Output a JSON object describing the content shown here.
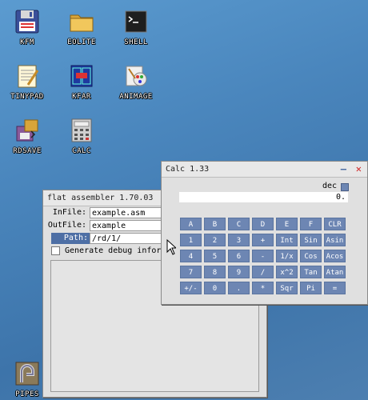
{
  "desktop": {
    "icons": [
      {
        "label": "KFM",
        "icon": "floppy-icon"
      },
      {
        "label": "EOLITE",
        "icon": "folder-icon"
      },
      {
        "label": "SHELL",
        "icon": "terminal-icon"
      },
      {
        "label": "TINYPAD",
        "icon": "notepad-icon"
      },
      {
        "label": "KFAR",
        "icon": "dual-panel-icon"
      },
      {
        "label": "ANIMAGE",
        "icon": "paint-icon"
      },
      {
        "label": "RDSAVE",
        "icon": "rdsave-icon"
      },
      {
        "label": "CALC",
        "icon": "calculator-icon"
      },
      {
        "label": "PIPES",
        "icon": "pipes-icon"
      }
    ]
  },
  "fasm": {
    "title": "flat assembler 1.70.03",
    "infile_label": "InFile:",
    "infile_value": "example.asm",
    "outfile_label": "OutFile:",
    "outfile_value": "example",
    "path_label": "Path:",
    "path_value": "/rd/1/",
    "debug_label": "Generate debug infor",
    "debug_checked": false
  },
  "calc": {
    "title": "Calc 1.33",
    "mode_label": "dec",
    "display_value": "0.",
    "buttons": [
      [
        "A",
        "B",
        "C",
        "D",
        "E",
        "F",
        "CLR"
      ],
      [
        "1",
        "2",
        "3",
        "+",
        "Int",
        "Sin",
        "Asin"
      ],
      [
        "4",
        "5",
        "6",
        "-",
        "1/x",
        "Cos",
        "Acos"
      ],
      [
        "7",
        "8",
        "9",
        "/",
        "x^2",
        "Tan",
        "Atan"
      ],
      [
        "+/-",
        "0",
        ".",
        "*",
        "Sqr",
        "Pi",
        "="
      ]
    ]
  },
  "colors": {
    "accent": "#4e6fa5",
    "button": "#6d86b3",
    "close": "#d02020"
  }
}
